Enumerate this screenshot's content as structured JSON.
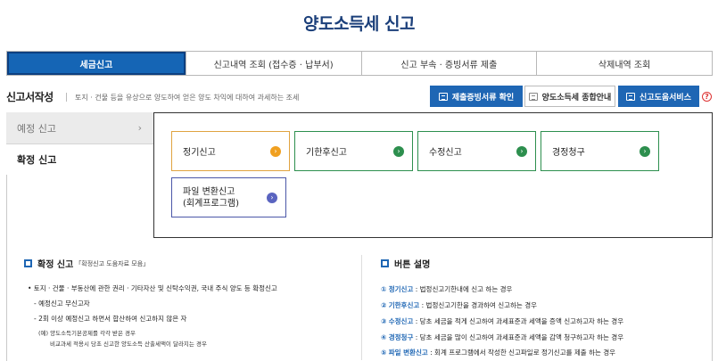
{
  "page_title": "양도소득세 신고",
  "tabs": [
    {
      "label": "세금신고"
    },
    {
      "label": "신고내역 조회 (접수증 · 납부서)"
    },
    {
      "label": "신고 부속 · 증빙서류 제출"
    },
    {
      "label": "삭제내역 조회"
    }
  ],
  "section": {
    "title": "신고서작성",
    "description": "토지 · 건물 등을 유상으로 양도하여 얻은 양도 차익에 대하여 과세하는 조세"
  },
  "actions": {
    "proof_docs": "제출증빙서류 확인",
    "guide": "양도소득세 종합안내",
    "help_service": "신고도움서비스",
    "help_mark": "?"
  },
  "side_menu": [
    {
      "label": "예정 신고",
      "chevron": "›"
    },
    {
      "label": "확정 신고"
    }
  ],
  "filing_types": [
    {
      "label": "정기신고"
    },
    {
      "label": "기한후신고"
    },
    {
      "label": "수정신고"
    },
    {
      "label": "경정청구"
    },
    {
      "label_line1": "파일 변환신고",
      "label_line2": "(회계프로그램)"
    }
  ],
  "arrow_glyph": "›",
  "info_left": {
    "title": "확정 신고",
    "subtitle": "「확정신고 도움자료 모음」",
    "lines": [
      "• 토지 · 건물 · 부동산에 관한 권리 · 기타자산 및 신탁수익권, 국내 주식 양도 등 확정신고",
      "- 예정신고 무신고자",
      "- 2회 이상 예정신고 하면서 합산하여 신고하지 않은 자",
      "(예) 양도소득기본공제를 각각 받은 경우",
      "비교과세 적용시 당초 신고한 양도소득 산출세액이 달라지는 경우"
    ]
  },
  "info_right": {
    "title": "버튼 설명",
    "items": [
      {
        "num": "①",
        "term": "정기신고",
        "desc": " : 법정신고기한내에 신고 하는 경우"
      },
      {
        "num": "②",
        "term": "기한후신고",
        "desc": " : 법정신고기한을 경과하여 신고하는 경우"
      },
      {
        "num": "③",
        "term": "수정신고",
        "desc": " : 당초 세금을 적게 신고하여 과세표준과 세액을 증액 신고하고자 하는 경우"
      },
      {
        "num": "④",
        "term": "경정청구",
        "desc": " : 당초 세금을 많이 신고하여 과세표준과 세액을 감액 청구하고자 하는 경우"
      },
      {
        "num": "⑤",
        "term": "파일 변환신고",
        "desc": " : 회계 프로그램에서 작성한 신고파일로 정기신고를 제출 하는 경우"
      }
    ]
  },
  "colors": {
    "primary": "#1565b5",
    "title": "#1b3f7a",
    "green": "#2d8f4e",
    "orange": "#f0a020",
    "purple": "#5a64c0"
  }
}
